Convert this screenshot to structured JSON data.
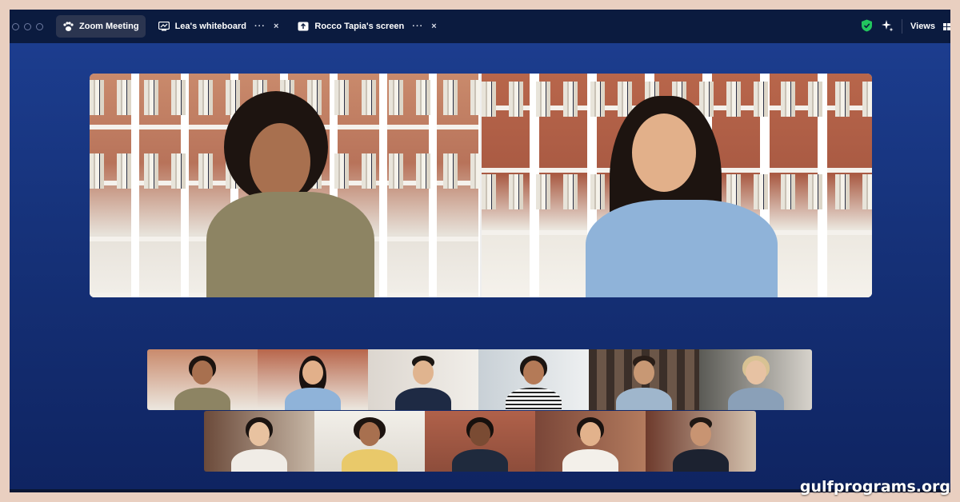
{
  "window": {
    "tabs": [
      {
        "label": "Zoom Meeting",
        "icon": "paw-icon",
        "active": true
      },
      {
        "label": "Lea's whiteboard",
        "icon": "whiteboard-icon",
        "more": "···",
        "close": "×"
      },
      {
        "label": "Rocco Tapia's screen",
        "icon": "share-screen-icon",
        "more": "···",
        "close": "×"
      }
    ],
    "tools": {
      "views_label": "Views",
      "shield_color": "#22c55e"
    }
  },
  "watermark": "gulfprograms.org",
  "colors": {
    "stage_bg_top": "#1d3f92",
    "stage_bg_bottom": "#0f2461",
    "titlebar": "#0b1b3f",
    "frame": "#e9cfc0"
  }
}
